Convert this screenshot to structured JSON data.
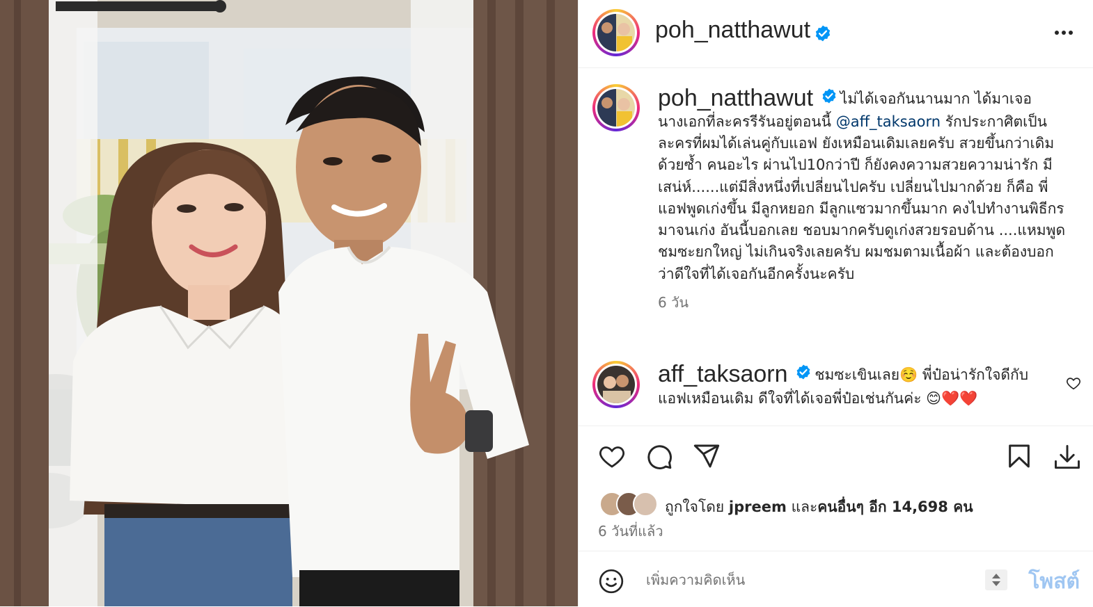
{
  "header": {
    "username": "poh_natthawut",
    "verified": true,
    "more_icon": "more-horizontal-icon"
  },
  "caption": {
    "username": "poh_natthawut",
    "text_before_mention": "ไม่ได้เจอกันนานมาก ได้มาเจอนางเอกที่ละครรีรันอยู่ตอนนี้ ",
    "mention": "@aff_taksaorn",
    "text_after_mention": " รักประกาศิตเป็นละครที่ผมได้เล่นคู่กับแอฟ ยังเหมือนเดิมเลยครับ สวยขึ้นกว่าเดิมด้วยซ้ำ คนอะไร ผ่านไป10กว่าปี ก็ยังคงความสวยความน่ารัก มีเสน่ห์......แต่มีสิ่งหนึ่งที่เปลี่ยนไปครับ เปลี่ยนไปมากด้วย ก็คือ พี่แอฟพูดเก่งขึ้น มีลูกหยอก มีลูกแซวมากขึ้นมาก คงไปทำงานพิธีกรมาจนเก่ง อันนี้บอกเลย ชอบมากครับดูเก่งสวยรอบด้าน ....แหมพูดชมซะยกใหญ่ ไม่เกินจริงเลยครับ ผมชมตามเนื้อผ้า และต้องบอกว่าดีใจที่ได้เจอกันอีกครั้งนะครับ",
    "time": "6 วัน"
  },
  "comment": {
    "username": "aff_taksaorn",
    "verified": true,
    "text": "ชมซะเขินเลย☺️ พี่ป๋อน่ารักใจดีกับแอฟเหมือนเดิม ดีใจที่ได้เจอพี่ป๋อเช่นกันค่ะ 😊❤️❤️"
  },
  "actions": {
    "like": "heart-icon",
    "comment": "comment-icon",
    "share": "share-icon",
    "save": "bookmark-icon",
    "download": "download-icon"
  },
  "likes": {
    "prefix": "ถูกใจโดย",
    "user": "jpreem",
    "joiner": "และ",
    "others_label": "คนอื่นๆ อีก 14,698 คน"
  },
  "posted": "6 วันที่แล้ว",
  "add_comment": {
    "placeholder": "เพิ่มความคิดเห็น",
    "post_label": "โพสต์"
  },
  "colors": {
    "mention": "#00376b",
    "verified": "#0095f6",
    "post_disabled": "#9fc6f2",
    "heart_red": "#e0245e"
  }
}
